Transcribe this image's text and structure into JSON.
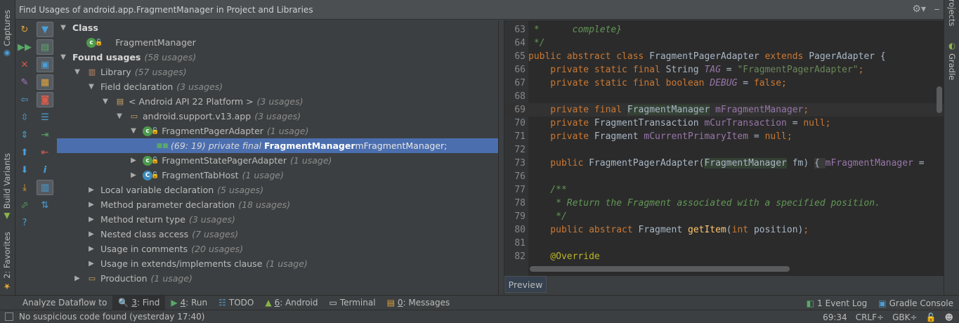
{
  "window_title": "Find Usages of android.app.FragmentManager in Project and Libraries",
  "left_edge_tabs": [
    "Captures",
    "Build Variants",
    "2: Favorites"
  ],
  "right_edge_tabs": [
    "Projects",
    "Gradle"
  ],
  "tree": [
    {
      "label": "Class",
      "bold": true
    },
    {
      "label": "FragmentManager"
    },
    {
      "label": "Found usages",
      "count": "(58 usages)",
      "bold": true
    },
    {
      "label": "Library",
      "count": "(57 usages)"
    },
    {
      "label": "Field declaration",
      "count": "(3 usages)"
    },
    {
      "label": "< Android API 22 Platform >",
      "count": "(3 usages)"
    },
    {
      "label": "android.support.v13.app",
      "count": "(3 usages)"
    },
    {
      "label": "FragmentPagerAdapter",
      "count": "(1 usage)"
    },
    {
      "prefix": "(69: 19) private final ",
      "bold_part": "FragmentManager",
      "suffix": " mFragmentManager;"
    },
    {
      "label": "FragmentStatePagerAdapter",
      "count": "(1 usage)"
    },
    {
      "label": "FragmentTabHost",
      "count": "(1 usage)"
    },
    {
      "label": "Local variable declaration",
      "count": "(5 usages)"
    },
    {
      "label": "Method parameter declaration",
      "count": "(18 usages)"
    },
    {
      "label": "Method return type",
      "count": "(3 usages)"
    },
    {
      "label": "Nested class access",
      "count": "(7 usages)"
    },
    {
      "label": "Usage in comments",
      "count": "(20 usages)"
    },
    {
      "label": "Usage in extends/implements clause",
      "count": "(1 usage)"
    },
    {
      "label": "Production",
      "count": "(1 usage)"
    }
  ],
  "code_lines": [
    {
      "n": "63",
      "t": "  *      complete}"
    },
    {
      "n": "64",
      "t": "  */"
    },
    {
      "n": "65",
      "t": "public abstract class FragmentPagerAdapter extends PagerAdapter {"
    },
    {
      "n": "66",
      "t": "    private static final String TAG = \"FragmentPagerAdapter\";"
    },
    {
      "n": "67",
      "t": "    private static final boolean DEBUG = false;"
    },
    {
      "n": "68",
      "t": ""
    },
    {
      "n": "69",
      "t": "    private final FragmentManager mFragmentManager;"
    },
    {
      "n": "70",
      "t": "    private FragmentTransaction mCurTransaction = null;"
    },
    {
      "n": "71",
      "t": "    private Fragment mCurrentPrimaryItem = null;"
    },
    {
      "n": "72",
      "t": ""
    },
    {
      "n": "73",
      "t": "    public FragmentPagerAdapter(FragmentManager fm) { mFragmentManager ="
    },
    {
      "n": "76",
      "t": ""
    },
    {
      "n": "77",
      "t": "    /**"
    },
    {
      "n": "78",
      "t": "     * Return the Fragment associated with a specified position."
    },
    {
      "n": "79",
      "t": "     */"
    },
    {
      "n": "80",
      "t": "    public abstract Fragment getItem(int position);"
    },
    {
      "n": "81",
      "t": ""
    },
    {
      "n": "82",
      "t": "    @Override"
    }
  ],
  "preview_tab": "Preview",
  "toolwindows": {
    "analyze": "Analyze Dataflow to",
    "find_num": "3",
    "find": ": Find",
    "run_num": "4",
    "run": ": Run",
    "todo": "TODO",
    "android_num": "6",
    "android": ": Android",
    "terminal": "Terminal",
    "messages_num": "0",
    "messages": ": Messages",
    "event_log_badge": "1",
    "event_log": "Event Log",
    "gradle_console": "Gradle Console"
  },
  "status": {
    "message": "No suspicious code found (yesterday 17:40)",
    "position": "69:34",
    "line_sep": "CRLF÷",
    "encoding": "GBK÷"
  },
  "colors": {
    "selection": "#4b6eaf",
    "panel": "#3c3f41",
    "editor": "#2b2b2b",
    "keyword": "#cc7832"
  }
}
